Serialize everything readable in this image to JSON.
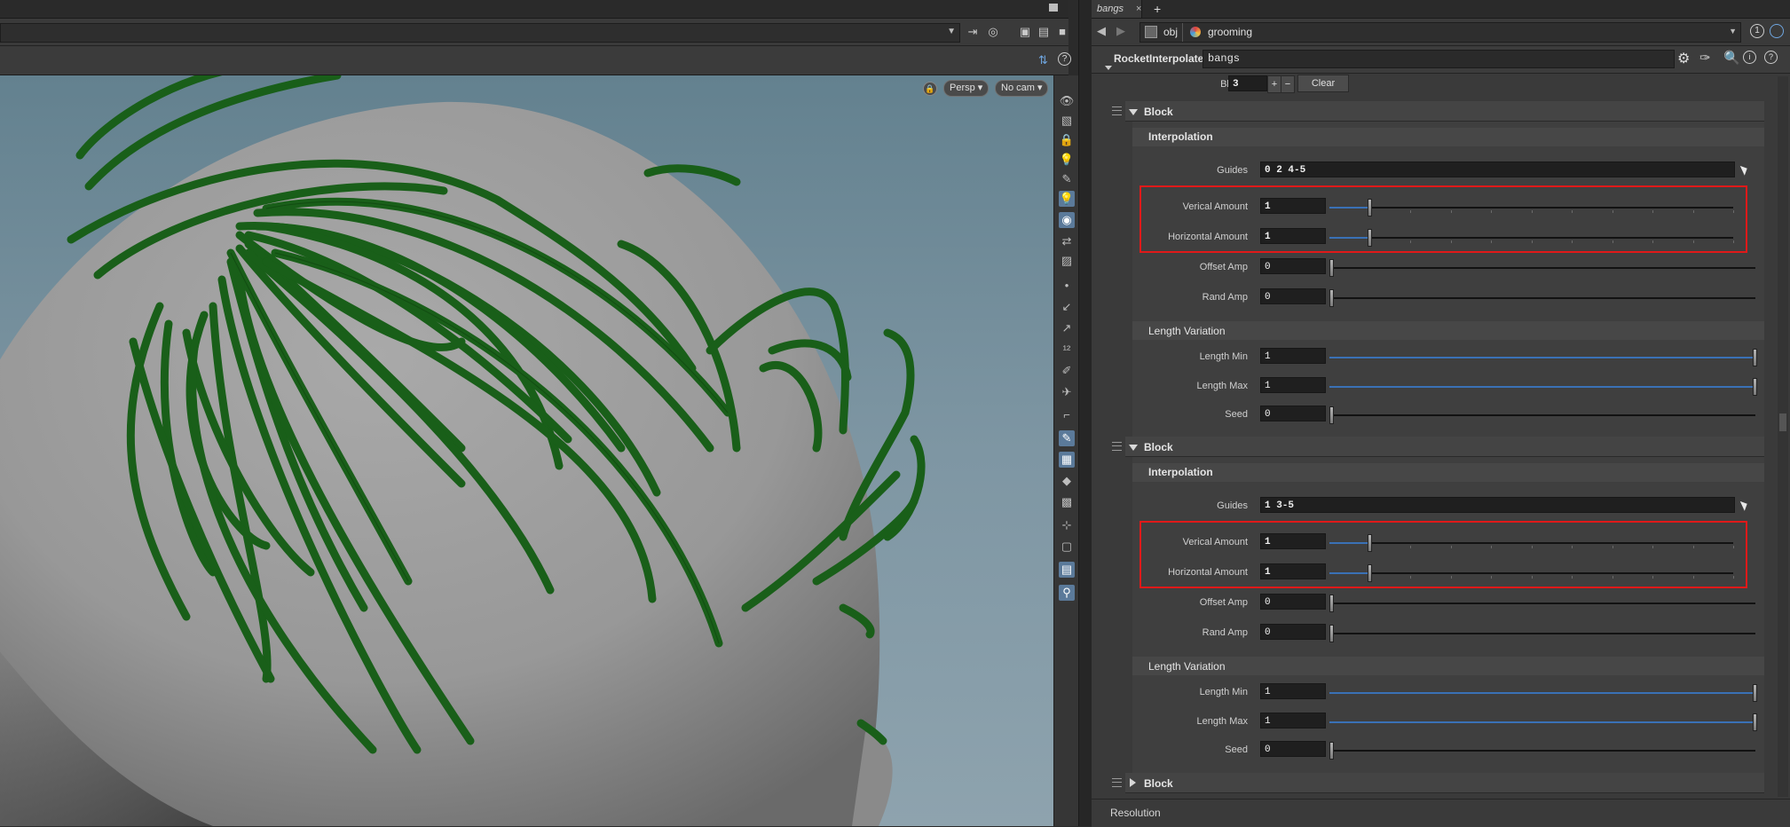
{
  "right_tab": {
    "label": "bangs"
  },
  "path": {
    "root": "obj",
    "node": "grooming"
  },
  "node": {
    "type": "RocketInterpolate",
    "name": "bangs"
  },
  "block_count": {
    "label": "Block",
    "value": "3",
    "plus": "+",
    "minus": "−",
    "clear": "Clear"
  },
  "viewport": {
    "persp": "Persp ▾",
    "cam": "No cam ▾"
  },
  "blocks": [
    {
      "title": "Block",
      "interpolation": "Interpolation",
      "guides": {
        "label": "Guides",
        "value": "0 2 4-5"
      },
      "vertical": {
        "label": "Verical Amount",
        "value": "1",
        "level": 0.1
      },
      "horizontal": {
        "label": "Horizontal Amount",
        "value": "1",
        "level": 0.1
      },
      "offset": {
        "label": "Offset Amp",
        "value": "0",
        "level": 0
      },
      "rand": {
        "label": "Rand Amp",
        "value": "0",
        "level": 0
      },
      "length_variation": "Length Variation",
      "length_min": {
        "label": "Length Min",
        "value": "1",
        "level": 1
      },
      "length_max": {
        "label": "Length Max",
        "value": "1",
        "level": 1
      },
      "seed": {
        "label": "Seed",
        "value": "0",
        "level": 0
      }
    },
    {
      "title": "Block",
      "interpolation": "Interpolation",
      "guides": {
        "label": "Guides",
        "value": "1 3-5"
      },
      "vertical": {
        "label": "Verical Amount",
        "value": "1",
        "level": 0.1
      },
      "horizontal": {
        "label": "Horizontal Amount",
        "value": "1",
        "level": 0.1
      },
      "offset": {
        "label": "Offset Amp",
        "value": "0",
        "level": 0
      },
      "rand": {
        "label": "Rand Amp",
        "value": "0",
        "level": 0
      },
      "length_variation": "Length Variation",
      "length_min": {
        "label": "Length Min",
        "value": "1",
        "level": 1
      },
      "length_max": {
        "label": "Length Max",
        "value": "1",
        "level": 1
      },
      "seed": {
        "label": "Seed",
        "value": "0",
        "level": 0
      }
    }
  ],
  "collapsed_block": {
    "title": "Block"
  },
  "footer": {
    "label": "Resolution"
  },
  "colors": {
    "accent": "#3a71b6",
    "highlight_box": "#e01919",
    "hair": "#1e6a1e",
    "head": "#9a9a9a"
  },
  "icons": [
    "pin-icon",
    "gear-icon",
    "search-icon",
    "help-icon",
    "back-arrow-icon",
    "forward-arrow-icon",
    "plus-icon",
    "close-icon",
    "lock-icon",
    "selection-pointer-icon"
  ]
}
